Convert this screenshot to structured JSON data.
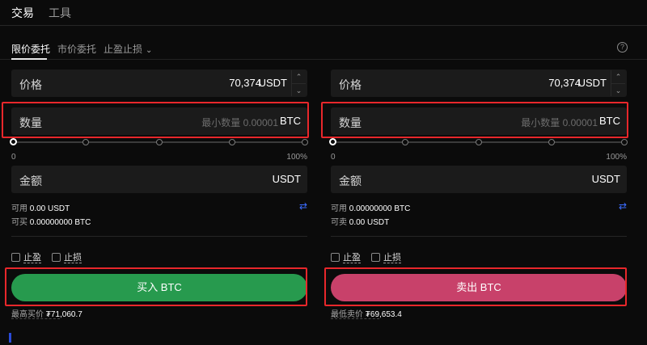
{
  "top_tabs": {
    "trade": "交易",
    "tools": "工具"
  },
  "order_tabs": {
    "limit": "限价委托",
    "market": "市价委托",
    "tpsl": "止盈止损"
  },
  "help_icon": "?",
  "stepper": {
    "up": "⌃",
    "down": "⌄"
  },
  "buy": {
    "price_label": "价格",
    "price_value": "70,374",
    "price_unit": "USDT",
    "qty_label": "数量",
    "qty_placeholder": "最小数量 0.00001",
    "qty_unit": "BTC",
    "slider_min": "0",
    "slider_max": "100%",
    "slider_value": 0,
    "amount_label": "金额",
    "amount_unit": "USDT",
    "avail_label": "可用",
    "avail_value": "0.00 USDT",
    "can_label": "可买",
    "can_value": "0.00000000 BTC",
    "take_profit": "止盈",
    "stop_loss": "止损",
    "button": "买入 BTC",
    "best_label": "最高买价",
    "best_value": "₮71,060.7"
  },
  "sell": {
    "price_label": "价格",
    "price_value": "70,374",
    "price_unit": "USDT",
    "qty_label": "数量",
    "qty_placeholder": "最小数量 0.00001",
    "qty_unit": "BTC",
    "slider_min": "0",
    "slider_max": "100%",
    "slider_value": 0,
    "amount_label": "金额",
    "amount_unit": "USDT",
    "avail_label": "可用",
    "avail_value": "0.00000000 BTC",
    "can_label": "可卖",
    "can_value": "0.00 USDT",
    "take_profit": "止盈",
    "stop_loss": "止损",
    "button": "卖出 BTC",
    "best_label": "最低卖价",
    "best_value": "₮69,653.4"
  },
  "colors": {
    "buy": "#279a4e",
    "sell": "#c8416a",
    "highlight": "#e8272b",
    "accent": "#3b6cff"
  },
  "icons": {
    "swap": "⇄",
    "chevron": "⌄"
  }
}
